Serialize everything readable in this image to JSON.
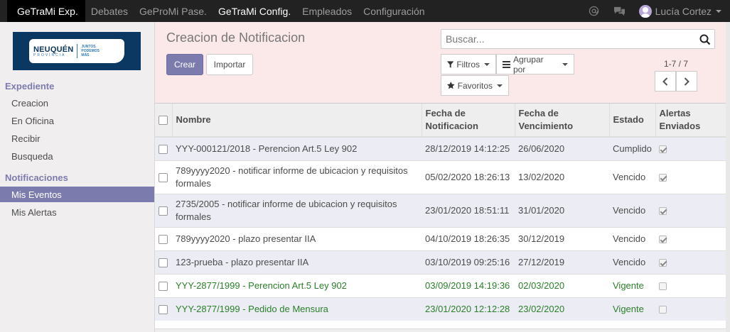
{
  "topbar": {
    "apps": [
      "GeTraMi Exp.",
      "Debates",
      "GeProMi Pase.",
      "GeTraMi Config.",
      "Empleados",
      "Configuración"
    ],
    "user_name": "Lucía Cortez",
    "icons": [
      "at-icon",
      "chat-icon",
      "avatar",
      "caret-down-icon"
    ]
  },
  "sidebar": {
    "logo": {
      "name": "NEUQUÉN",
      "sub": "PROVINCIA",
      "tag": "JUNTOS PODEMOS MÁS"
    },
    "sections": [
      {
        "title": "Expediente",
        "items": [
          "Creacion",
          "En Oficina",
          "Recibir",
          "Busqueda"
        ]
      },
      {
        "title": "Notificaciones",
        "items": [
          "Mis Eventos",
          "Mis Alertas"
        ]
      }
    ],
    "active_item": "Mis Eventos"
  },
  "control_panel": {
    "title": "Creacion de Notificacion",
    "create_label": "Crear",
    "import_label": "Importar",
    "search_placeholder": "Buscar...",
    "filters_label": "Filtros",
    "group_by_label": "Agrupar por",
    "favorites_label": "Favoritos",
    "pager": "1-7 / 7"
  },
  "table": {
    "columns": [
      "Nombre",
      "Fecha de Notificacion",
      "Fecha de Vencimiento",
      "Estado",
      "Alertas Enviados"
    ],
    "rows": [
      {
        "nombre": "YYY-000121/2018 - Perencion Art.5 Ley 902",
        "notif": "28/12/2019 14:12:25",
        "venc": "26/06/2020",
        "estado": "Cumplido",
        "alertas": true,
        "color": "default"
      },
      {
        "nombre": "789yyyy2020 - notificar informe de ubicacion y requisitos formales",
        "notif": "05/02/2020 18:26:13",
        "venc": "13/02/2020",
        "estado": "Vencido",
        "alertas": true,
        "color": "default"
      },
      {
        "nombre": "2735/2005 - notificar informe de ubicacion y requisitos formales",
        "notif": "23/01/2020 18:51:11",
        "venc": "31/01/2020",
        "estado": "Vencido",
        "alertas": true,
        "color": "default"
      },
      {
        "nombre": "789yyyy2020 - plazo presentar IIA",
        "notif": "04/10/2019 18:26:35",
        "venc": "30/12/2019",
        "estado": "Vencido",
        "alertas": true,
        "color": "default"
      },
      {
        "nombre": "123-prueba - plazo presentar IIA",
        "notif": "03/10/2019 09:25:16",
        "venc": "27/12/2019",
        "estado": "Vencido",
        "alertas": true,
        "color": "default"
      },
      {
        "nombre": "YYY-2877/1999 - Perencion Art.5 Ley 902",
        "notif": "03/09/2019 14:19:36",
        "venc": "02/03/2020",
        "estado": "Vigente",
        "alertas": false,
        "color": "green"
      },
      {
        "nombre": "YYY-2877/1999 - Pedido de Mensura",
        "notif": "23/01/2020 12:12:28",
        "venc": "23/02/2020",
        "estado": "Vigente",
        "alertas": false,
        "color": "green"
      }
    ]
  },
  "colors": {
    "accent": "#7c7bad",
    "topbar": "#222222",
    "sidebar_bg": "#f0eeee",
    "control_panel_bg": "#fbe9e9",
    "vigente_text": "#2a7f2a"
  }
}
